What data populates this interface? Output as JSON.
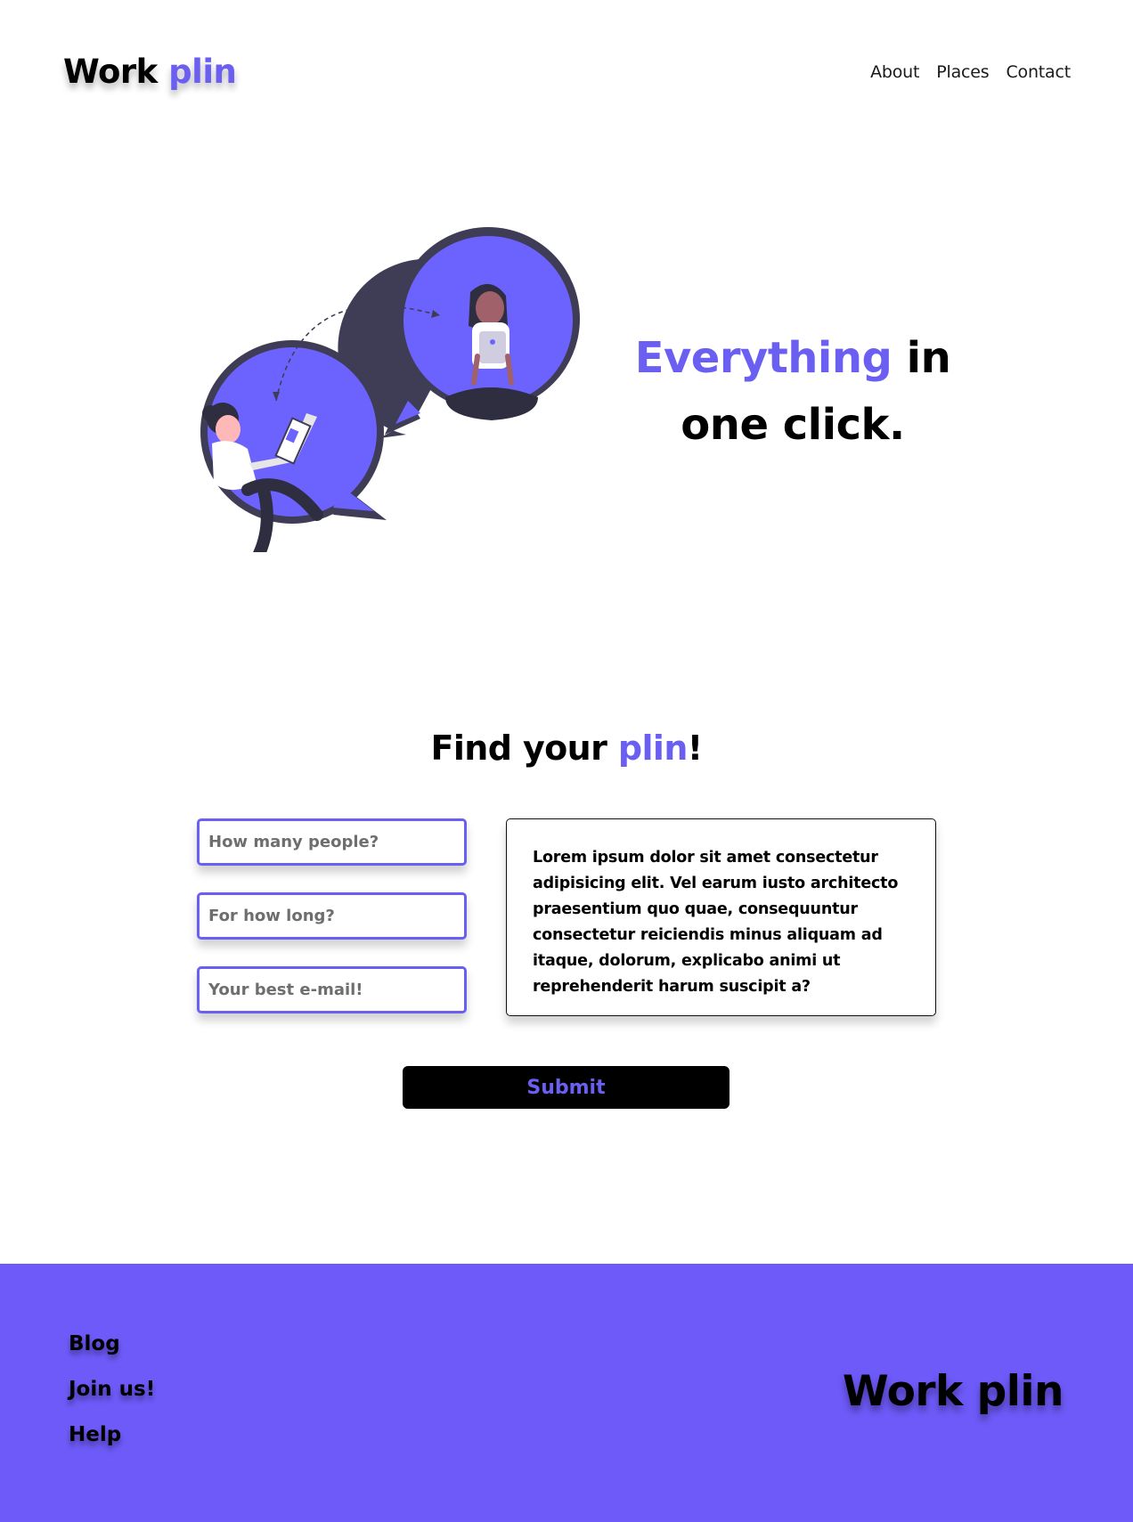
{
  "header": {
    "logo_primary": "Work",
    "logo_accent": "plin",
    "nav": [
      {
        "label": "About"
      },
      {
        "label": "Places"
      },
      {
        "label": "Contact"
      }
    ]
  },
  "hero": {
    "headline_accent": "Everything",
    "headline_rest_1": "in",
    "headline_rest_2": "one click."
  },
  "finder": {
    "title_prefix": "Find your",
    "title_accent": "plin",
    "title_suffix": "!",
    "fields": [
      {
        "placeholder": "How many people?",
        "value": ""
      },
      {
        "placeholder": "For how long?",
        "value": ""
      },
      {
        "placeholder": "Your best e-mail!",
        "value": ""
      }
    ],
    "description": "Lorem ipsum dolor sit amet consectetur adipisicing elit. Vel earum iusto architecto praesentium quo quae, consequuntur consectetur reiciendis minus aliquam ad itaque, dolorum, explicabo animi ut reprehenderit harum suscipit a?",
    "submit_label": "Submit"
  },
  "footer": {
    "links": [
      {
        "label": "Blog"
      },
      {
        "label": "Join us!"
      },
      {
        "label": "Help"
      }
    ],
    "brand": "Work plin"
  },
  "colors": {
    "accent": "#6b5ff2",
    "footer_bg": "#6e5af9",
    "text": "#000000"
  }
}
